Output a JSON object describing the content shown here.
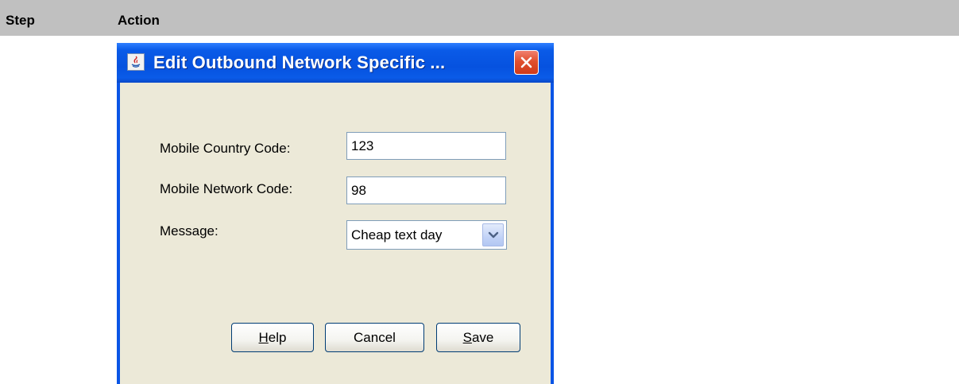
{
  "table_header": {
    "step_label": "Step",
    "action_label": "Action"
  },
  "dialog": {
    "title": "Edit Outbound Network Specific ...",
    "title_icon": "java-app-icon",
    "close_icon": "close-icon",
    "fields": {
      "mcc": {
        "label": "Mobile Country Code:",
        "value": "123"
      },
      "mnc": {
        "label": "Mobile Network Code:",
        "value": "98"
      },
      "message": {
        "label": "Message:",
        "selected": "Cheap text day"
      }
    },
    "buttons": {
      "help": {
        "mnemonic": "H",
        "rest": "elp"
      },
      "cancel": {
        "label": "Cancel"
      },
      "save": {
        "mnemonic": "S",
        "rest": "ave"
      }
    }
  }
}
